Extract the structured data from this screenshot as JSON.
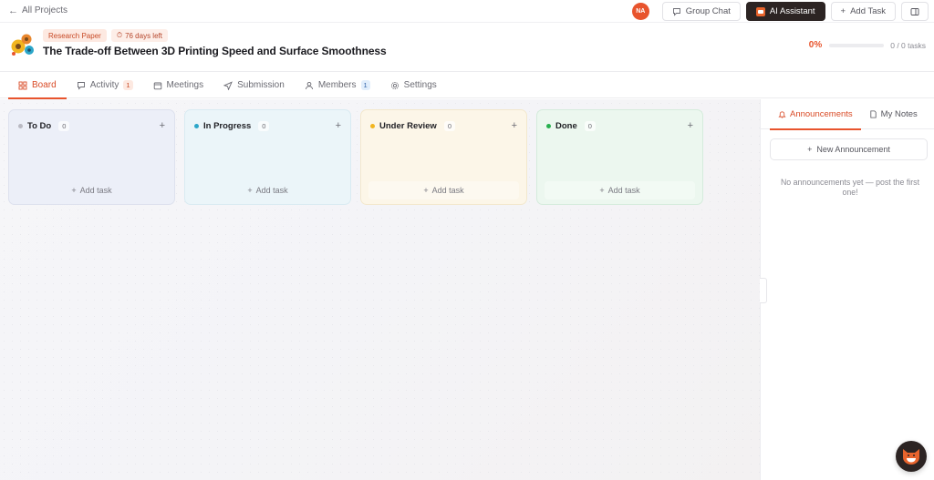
{
  "topbar": {
    "back_label": "All Projects",
    "avatar_initials": "NA",
    "group_chat_label": "Group Chat",
    "ai_assistant_label": "AI Assistant",
    "add_task_label": "Add Task"
  },
  "project": {
    "type_tag": "Research Paper",
    "deadline_tag": "76 days left",
    "title": "The Trade-off Between 3D Printing Speed and Surface Smoothness",
    "progress_label": "0%",
    "progress_fraction": 0,
    "task_count": "0 / 0 tasks"
  },
  "tabs": [
    {
      "label": "Board",
      "icon": "board-icon"
    },
    {
      "label": "Activity",
      "icon": "chat-icon",
      "count": "1"
    },
    {
      "label": "Meetings",
      "icon": "calendar-icon"
    },
    {
      "label": "Submission",
      "icon": "send-icon"
    },
    {
      "label": "Members",
      "icon": "user-icon",
      "count": "1"
    },
    {
      "label": "Settings",
      "icon": "gear-icon"
    }
  ],
  "board": {
    "columns": [
      {
        "name": "To Do",
        "count": "0",
        "dot_color": "#b9b9c2",
        "add_label": "Add task"
      },
      {
        "name": "In Progress",
        "count": "0",
        "dot_color": "#2ba6c9",
        "add_label": "Add task"
      },
      {
        "name": "Under Review",
        "count": "0",
        "dot_color": "#f2b51f",
        "add_label": "Add task"
      },
      {
        "name": "Done",
        "count": "0",
        "dot_color": "#28b04f",
        "add_label": "Add task"
      }
    ]
  },
  "side_panel": {
    "tabs": [
      {
        "label": "Announcements",
        "icon": "bell-icon"
      },
      {
        "label": "My Notes",
        "icon": "note-icon"
      }
    ],
    "new_announcement_label": "New Announcement",
    "empty_text": "No announcements yet — post the first one!"
  },
  "colors": {
    "accent": "#e8542d",
    "dark": "#2c2423"
  }
}
